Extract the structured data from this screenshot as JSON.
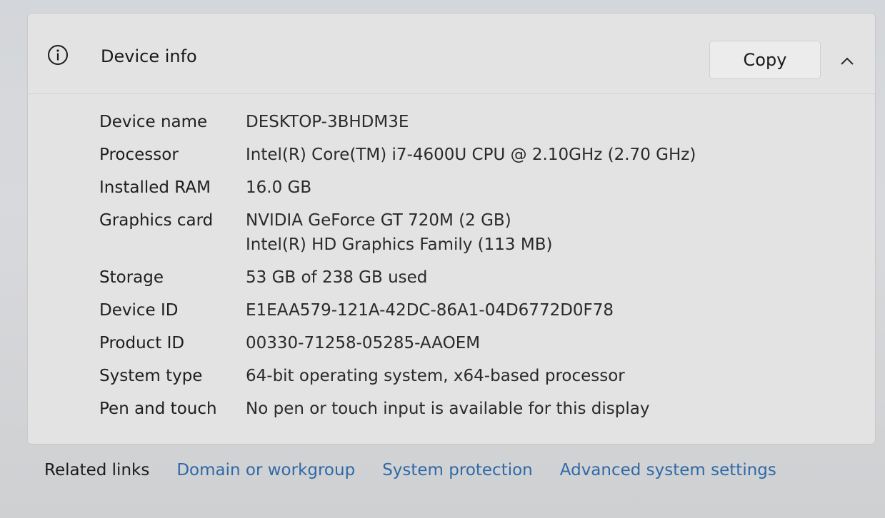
{
  "device_info": {
    "title": "Device info",
    "copy_label": "Copy",
    "specs": [
      {
        "label": "Device name",
        "values": [
          "DESKTOP-3BHDM3E"
        ]
      },
      {
        "label": "Processor",
        "values": [
          "Intel(R) Core(TM) i7-4600U CPU @ 2.10GHz (2.70 GHz)"
        ]
      },
      {
        "label": "Installed RAM",
        "values": [
          "16.0 GB"
        ]
      },
      {
        "label": "Graphics card",
        "values": [
          "NVIDIA GeForce GT 720M (2 GB)",
          "Intel(R) HD Graphics Family (113 MB)"
        ]
      },
      {
        "label": "Storage",
        "values": [
          "53 GB of 238 GB used"
        ]
      },
      {
        "label": "Device ID",
        "values": [
          "E1EAA579-121A-42DC-86A1-04D6772D0F78"
        ]
      },
      {
        "label": "Product ID",
        "values": [
          "00330-71258-05285-AAOEM"
        ]
      },
      {
        "label": "System type",
        "values": [
          "64-bit operating system, x64-based processor"
        ]
      },
      {
        "label": "Pen and touch",
        "values": [
          "No pen or touch input is available for this display"
        ]
      }
    ]
  },
  "related_links": {
    "label": "Related links",
    "links": [
      "Domain or workgroup",
      "System protection",
      "Advanced system settings"
    ]
  },
  "colors": {
    "link": "#2f6aa6",
    "panel_background": "#e3e3e3"
  },
  "icons": {
    "header": "info-icon",
    "collapse": "chevron-up-icon"
  }
}
